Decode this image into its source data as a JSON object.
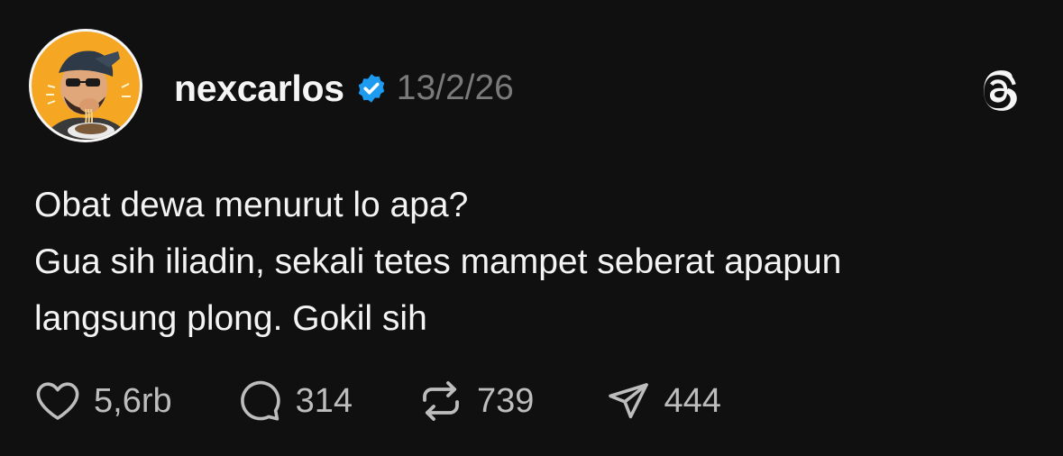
{
  "post": {
    "username": "nexcarlos",
    "timestamp": "13/2/26",
    "body_lines": [
      "Obat dewa menurut lo apa?",
      "Gua sih iliadin, sekali tetes mampet seberat apapun",
      "langsung plong. Gokil sih"
    ]
  },
  "actions": {
    "likes": "5,6rb",
    "replies": "314",
    "reposts": "739",
    "shares": "444"
  },
  "icons": {
    "avatar": "avatar-photo",
    "verified": "verified-badge-icon",
    "brand": "threads-logo-icon",
    "like": "heart-icon",
    "reply": "speech-bubble-icon",
    "repost": "repost-arrows-icon",
    "share": "paper-plane-icon"
  },
  "colors": {
    "background": "#101010",
    "text": "#f3f3f3",
    "muted": "#7a7a7a",
    "verified_blue": "#1d9bf0",
    "avatar_bg": "#f5a623"
  }
}
